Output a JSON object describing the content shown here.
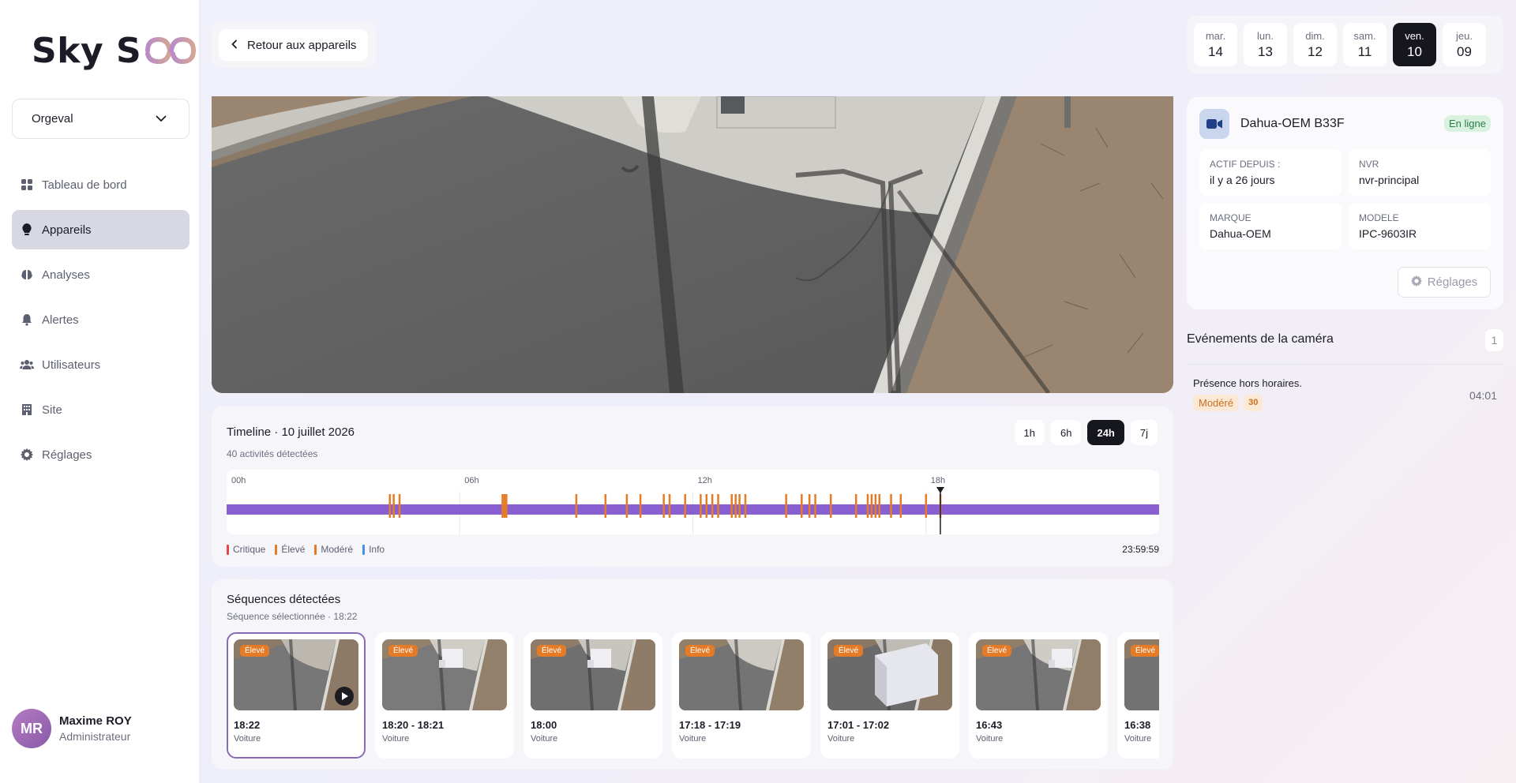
{
  "brand": {
    "name": "Sky See",
    "accent": "#8b6ab8",
    "accent_dark": "#16161e"
  },
  "site_selector": {
    "value": "Orgeval"
  },
  "sidebar": {
    "items": [
      {
        "label": "Tableau de bord",
        "icon": "dashboard-grid-icon",
        "active": false
      },
      {
        "label": "Appareils",
        "icon": "lightbulb-icon",
        "active": true
      },
      {
        "label": "Analyses",
        "icon": "brain-icon",
        "active": false
      },
      {
        "label": "Alertes",
        "icon": "bell-icon",
        "active": false
      },
      {
        "label": "Utilisateurs",
        "icon": "users-icon",
        "active": false
      },
      {
        "label": "Site",
        "icon": "building-icon",
        "active": false
      },
      {
        "label": "Réglages",
        "icon": "gear-icon",
        "active": false
      }
    ]
  },
  "user": {
    "initials": "MR",
    "name": "Maxime ROY",
    "role": "Administrateur"
  },
  "header": {
    "back_label": "Retour aux appareils"
  },
  "days": [
    {
      "name": "mar.",
      "num": "14",
      "active": false
    },
    {
      "name": "lun.",
      "num": "13",
      "active": false
    },
    {
      "name": "dim.",
      "num": "12",
      "active": false
    },
    {
      "name": "sam.",
      "num": "11",
      "active": false
    },
    {
      "name": "ven.",
      "num": "10",
      "active": true
    },
    {
      "name": "jeu.",
      "num": "09",
      "active": false
    }
  ],
  "camera": {
    "name": "Dahua-OEM B33F",
    "status": "En ligne",
    "status_color": "#2b7d47",
    "info": [
      {
        "label": "Actif depuis :",
        "value": "il y a 26 jours"
      },
      {
        "label": "NVR",
        "value": "nvr-principal"
      },
      {
        "label": "Marque",
        "value": "Dahua-OEM"
      },
      {
        "label": "Modele",
        "value": "IPC-9603IR"
      }
    ],
    "settings_label": "Réglages"
  },
  "events": {
    "title": "Evénements de la caméra",
    "count": "1",
    "items": [
      {
        "title": "Présence hors horaires.",
        "severity": "Modéré",
        "score": "30",
        "time": "04:01"
      }
    ]
  },
  "timeline": {
    "title": "Timeline · 10 juillet 2026",
    "subtitle": "40 activités détectées",
    "ranges": [
      {
        "label": "1h",
        "active": false
      },
      {
        "label": "6h",
        "active": false
      },
      {
        "label": "24h",
        "active": true
      },
      {
        "label": "7j",
        "active": false
      }
    ],
    "hour_labels": [
      "00h",
      "06h",
      "12h",
      "18h"
    ],
    "end_time": "23:59:59",
    "cursor_hour": 18.37,
    "track_color": "#8a5fd2",
    "legend": [
      {
        "label": "Critique",
        "color": "#e04848"
      },
      {
        "label": "Élevé",
        "color": "#e57b27"
      },
      {
        "label": "Modéré",
        "color": "#e57b27"
      },
      {
        "label": "Info",
        "color": "#4a90e2"
      }
    ],
    "event_color": "#e57b27",
    "events_hours": [
      4.2,
      4.3,
      4.45,
      7.1,
      7.15,
      7.2,
      9.0,
      9.75,
      10.3,
      10.65,
      11.25,
      11.4,
      11.8,
      12.2,
      12.35,
      12.5,
      12.65,
      13.0,
      13.1,
      13.2,
      13.35,
      14.4,
      14.8,
      15.0,
      15.15,
      15.55,
      16.2,
      16.5,
      16.6,
      16.7,
      16.8,
      17.1,
      17.35,
      18.0,
      18.37
    ]
  },
  "sequences": {
    "title": "Séquences détectées",
    "subtitle": "Séquence sélectionnée · 18:22",
    "items": [
      {
        "time": "18:22",
        "type": "Voiture",
        "badge": "Élevé",
        "selected": true
      },
      {
        "time": "18:20 - 18:21",
        "type": "Voiture",
        "badge": "Élevé",
        "selected": false
      },
      {
        "time": "18:00",
        "type": "Voiture",
        "badge": "Élevé",
        "selected": false
      },
      {
        "time": "17:18 - 17:19",
        "type": "Voiture",
        "badge": "Élevé",
        "selected": false
      },
      {
        "time": "17:01 - 17:02",
        "type": "Voiture",
        "badge": "Élevé",
        "selected": false
      },
      {
        "time": "16:43",
        "type": "Voiture",
        "badge": "Élevé",
        "selected": false
      },
      {
        "time": "16:38",
        "type": "Voiture",
        "badge": "Élevé",
        "selected": false
      }
    ]
  }
}
